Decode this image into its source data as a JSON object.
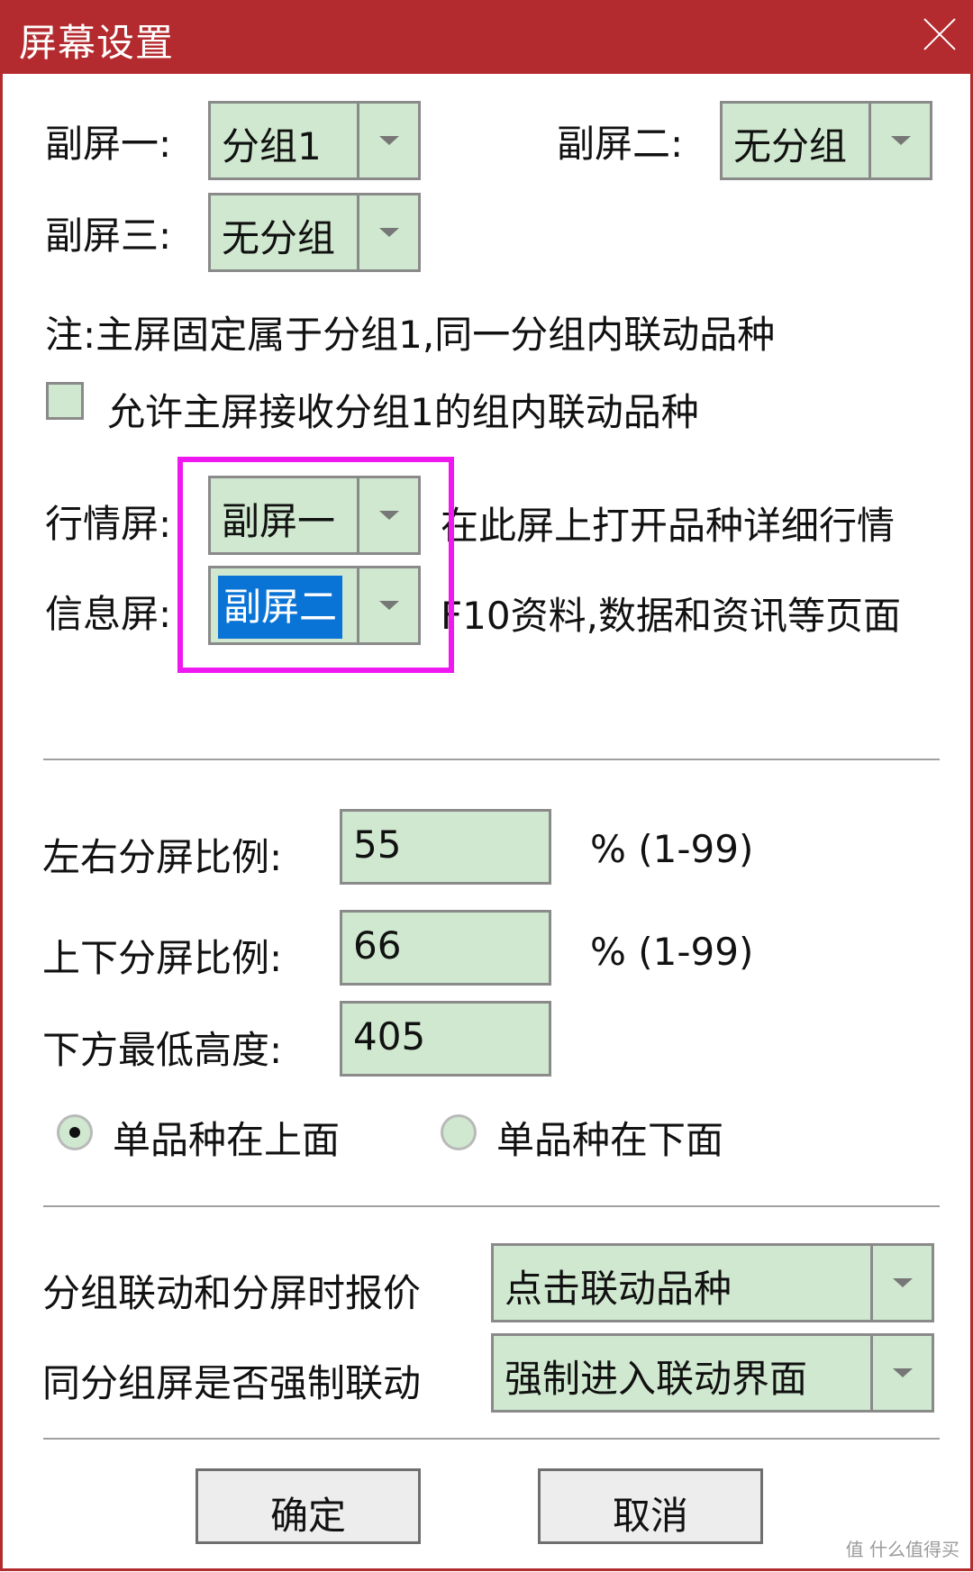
{
  "window": {
    "title": "屏幕设置"
  },
  "sub_screens": {
    "s1_label": "副屏一:",
    "s1_value": "分组1",
    "s2_label": "副屏二:",
    "s2_value": "无分组",
    "s3_label": "副屏三:",
    "s3_value": "无分组"
  },
  "note": "注:主屏固定属于分组1,同一分组内联动品种",
  "allow_checkbox": {
    "label": "允许主屏接收分组1的组内联动品种",
    "checked": false
  },
  "quote_screen": {
    "label": "行情屏:",
    "value": "副屏一",
    "desc": "在此屏上打开品种详细行情"
  },
  "info_screen": {
    "label": "信息屏:",
    "value": "副屏二",
    "desc": "F10资料,数据和资讯等页面"
  },
  "ratios": {
    "lr_label": "左右分屏比例:",
    "lr_value": "55",
    "lr_hint": "% (1-99)",
    "ud_label": "上下分屏比例:",
    "ud_value": "66",
    "ud_hint": "% (1-99)",
    "min_label": "下方最低高度:",
    "min_value": "405"
  },
  "position": {
    "top_label": "单品种在上面",
    "bottom_label": "单品种在下面",
    "selected": "top"
  },
  "linkage": {
    "quote_label": "分组联动和分屏时报价",
    "quote_value": "点击联动品种",
    "force_label": "同分组屏是否强制联动",
    "force_value": "强制进入联动界面"
  },
  "buttons": {
    "ok": "确定",
    "cancel": "取消"
  },
  "watermark": "值 什么值得买",
  "colors": {
    "titlebar": "#b42b2f",
    "field": "#cfe8cf",
    "highlight": "#f018f0",
    "selection": "#0a74d6"
  }
}
